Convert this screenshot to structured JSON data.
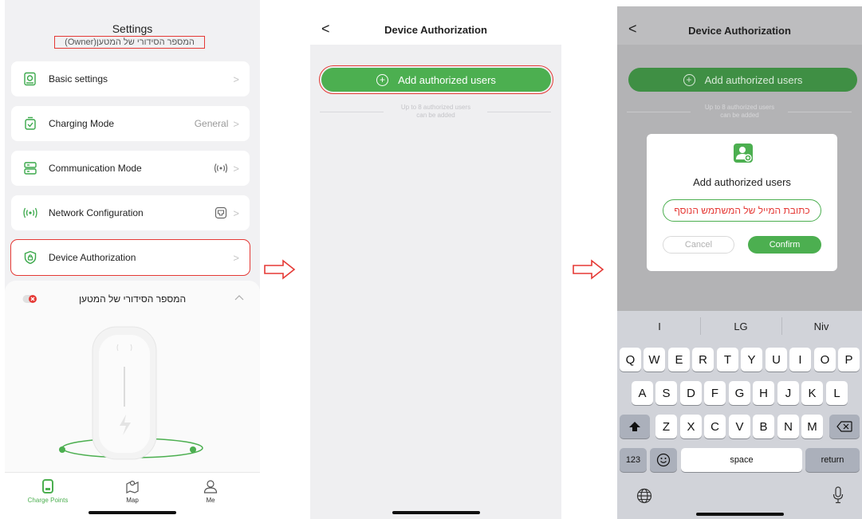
{
  "settings": {
    "title": "Settings",
    "subtitle": "המספר הסידורי של המטען(Owner)",
    "items": [
      {
        "label": "Basic settings",
        "value": "",
        "icon": "settings-card-icon",
        "right_icon": ""
      },
      {
        "label": "Charging Mode",
        "value": "General",
        "icon": "charging-mode-icon",
        "right_icon": ""
      },
      {
        "label": "Communication Mode",
        "value": "",
        "icon": "communication-icon",
        "right_icon": "wireless-signal-icon"
      },
      {
        "label": "Network Configuration",
        "value": "",
        "icon": "network-signal-icon",
        "right_icon": "ethernet-port-icon"
      },
      {
        "label": "Device Authorization",
        "value": "",
        "icon": "shield-lock-icon",
        "right_icon": ""
      }
    ],
    "chevron": ">",
    "device_name": "המספר הסידורי של המטען",
    "collapse": "^",
    "tabs": [
      {
        "label": "Charge Points",
        "icon": "charger-icon"
      },
      {
        "label": "Map",
        "icon": "map-icon"
      },
      {
        "label": "Me",
        "icon": "user-icon"
      }
    ]
  },
  "authorization": {
    "back": "<",
    "title": "Device Authorization",
    "add_button": "Add authorized users",
    "plus": "+",
    "hint_line1": "Up to 8 authorized users",
    "hint_line2": "can be added"
  },
  "dialog": {
    "title": "Add authorized users",
    "input_placeholder": "כתובת המייל של המשתמש הנוסף",
    "cancel": "Cancel",
    "confirm": "Confirm"
  },
  "keyboard": {
    "suggestions": [
      "I",
      "LG",
      "Niv"
    ],
    "row1": [
      "Q",
      "W",
      "E",
      "R",
      "T",
      "Y",
      "U",
      "I",
      "O",
      "P"
    ],
    "row2": [
      "A",
      "S",
      "D",
      "F",
      "G",
      "H",
      "J",
      "K",
      "L"
    ],
    "row3": [
      "Z",
      "X",
      "C",
      "V",
      "B",
      "N",
      "M"
    ],
    "numbers": "123",
    "space": "space",
    "return": "return"
  },
  "colors": {
    "accent": "#4caf50",
    "highlight": "#e53935"
  }
}
